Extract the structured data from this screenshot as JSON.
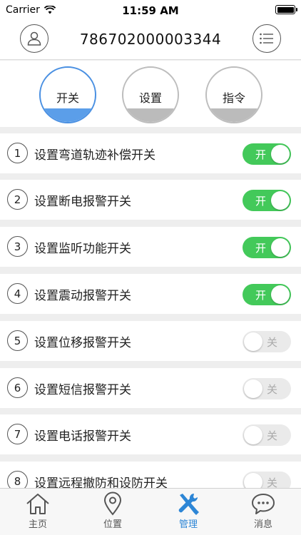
{
  "status_bar": {
    "carrier": "Carrier",
    "time": "11:59 AM"
  },
  "header": {
    "device_id": "786702000003344"
  },
  "tabs": [
    {
      "label": "开关",
      "active": true
    },
    {
      "label": "设置",
      "active": false
    },
    {
      "label": "指令",
      "active": false
    }
  ],
  "settings": [
    {
      "num": "1",
      "label": "设置弯道轨迹补偿开关",
      "state": "开",
      "on": true
    },
    {
      "num": "2",
      "label": "设置断电报警开关",
      "state": "开",
      "on": true
    },
    {
      "num": "3",
      "label": "设置监听功能开关",
      "state": "开",
      "on": true
    },
    {
      "num": "4",
      "label": "设置震动报警开关",
      "state": "开",
      "on": true
    },
    {
      "num": "5",
      "label": "设置位移报警开关",
      "state": "关",
      "on": false
    },
    {
      "num": "6",
      "label": "设置短信报警开关",
      "state": "关",
      "on": false
    },
    {
      "num": "7",
      "label": "设置电话报警开关",
      "state": "关",
      "on": false
    },
    {
      "num": "8",
      "label": "设置远程撤防和设防开关",
      "state": "关",
      "on": false
    }
  ],
  "tabbar": [
    {
      "label": "主页",
      "icon": "home-icon",
      "active": false
    },
    {
      "label": "位置",
      "icon": "location-pin-icon",
      "active": false
    },
    {
      "label": "管理",
      "icon": "tools-icon",
      "active": true
    },
    {
      "label": "消息",
      "icon": "chat-bubble-icon",
      "active": false
    }
  ],
  "colors": {
    "accent": "#2d86d6",
    "toggle_on": "#43c95a",
    "tab_active": "#5b9ee9"
  }
}
